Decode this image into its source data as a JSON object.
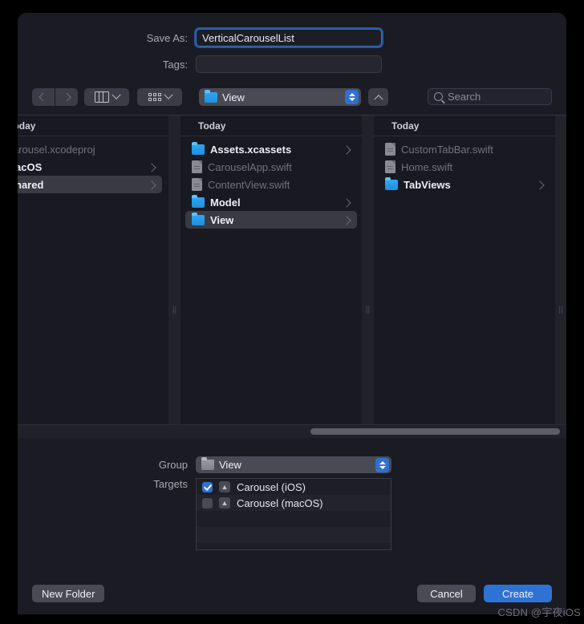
{
  "dialog": {
    "save_as_label": "Save As:",
    "save_as_value": "VerticalCarouselList",
    "tags_label": "Tags:",
    "tags_value": "",
    "tags_placeholder": ""
  },
  "toolbar": {
    "back_icon": "chevron-left-icon",
    "forward_icon": "chevron-right-icon",
    "column_view_icon": "column-view-icon",
    "grid_view_icon": "icon-view-icon",
    "path_popup_label": "View",
    "path_popup_icon": "folder-icon",
    "up_icon": "chevron-up-icon",
    "search_icon": "search-icon",
    "search_placeholder": "Search",
    "search_value": ""
  },
  "browser": {
    "columns": [
      {
        "header": "Today",
        "clipped": true,
        "rows": [
          {
            "label": "arousel.xcodeproj",
            "type": "file",
            "selected": false,
            "has_arrow": false
          },
          {
            "label": "acOS",
            "type": "folder",
            "selected": false,
            "has_arrow": true
          },
          {
            "label": "hared",
            "type": "folder",
            "selected": true,
            "has_arrow": true
          }
        ]
      },
      {
        "header": "Today",
        "clipped": false,
        "rows": [
          {
            "label": "Assets.xcassets",
            "type": "folder",
            "selected": false,
            "has_arrow": true
          },
          {
            "label": "CarouselApp.swift",
            "type": "file",
            "selected": false,
            "has_arrow": false
          },
          {
            "label": "ContentView.swift",
            "type": "file",
            "selected": false,
            "has_arrow": false
          },
          {
            "label": "Model",
            "type": "folder",
            "selected": false,
            "has_arrow": true
          },
          {
            "label": "View",
            "type": "folder",
            "selected": true,
            "has_arrow": true
          }
        ]
      },
      {
        "header": "Today",
        "clipped": false,
        "rows": [
          {
            "label": "CustomTabBar.swift",
            "type": "file",
            "selected": false,
            "has_arrow": false
          },
          {
            "label": "Home.swift",
            "type": "file",
            "selected": false,
            "has_arrow": false
          },
          {
            "label": "TabViews",
            "type": "folder",
            "selected": false,
            "has_arrow": true
          }
        ]
      }
    ],
    "column_grip_glyph": "||"
  },
  "accessory": {
    "group_label": "Group",
    "group_value": "View",
    "group_icon": "folder-icon",
    "targets_label": "Targets",
    "targets": [
      {
        "label": "Carousel (iOS)",
        "checked": true,
        "icon": "app-target-icon"
      },
      {
        "label": "Carousel (macOS)",
        "checked": false,
        "icon": "app-target-icon"
      }
    ]
  },
  "footer": {
    "new_folder_label": "New Folder",
    "cancel_label": "Cancel",
    "create_label": "Create"
  },
  "watermark": {
    "text": "CSDN @宇夜iOS"
  },
  "colors": {
    "accent_blue": "#2f72d6",
    "dialog_bg": "#1b1b23",
    "browser_bg": "#191922",
    "selection_gray": "#3a3a42",
    "folder_blue": "#2fa6ef"
  }
}
